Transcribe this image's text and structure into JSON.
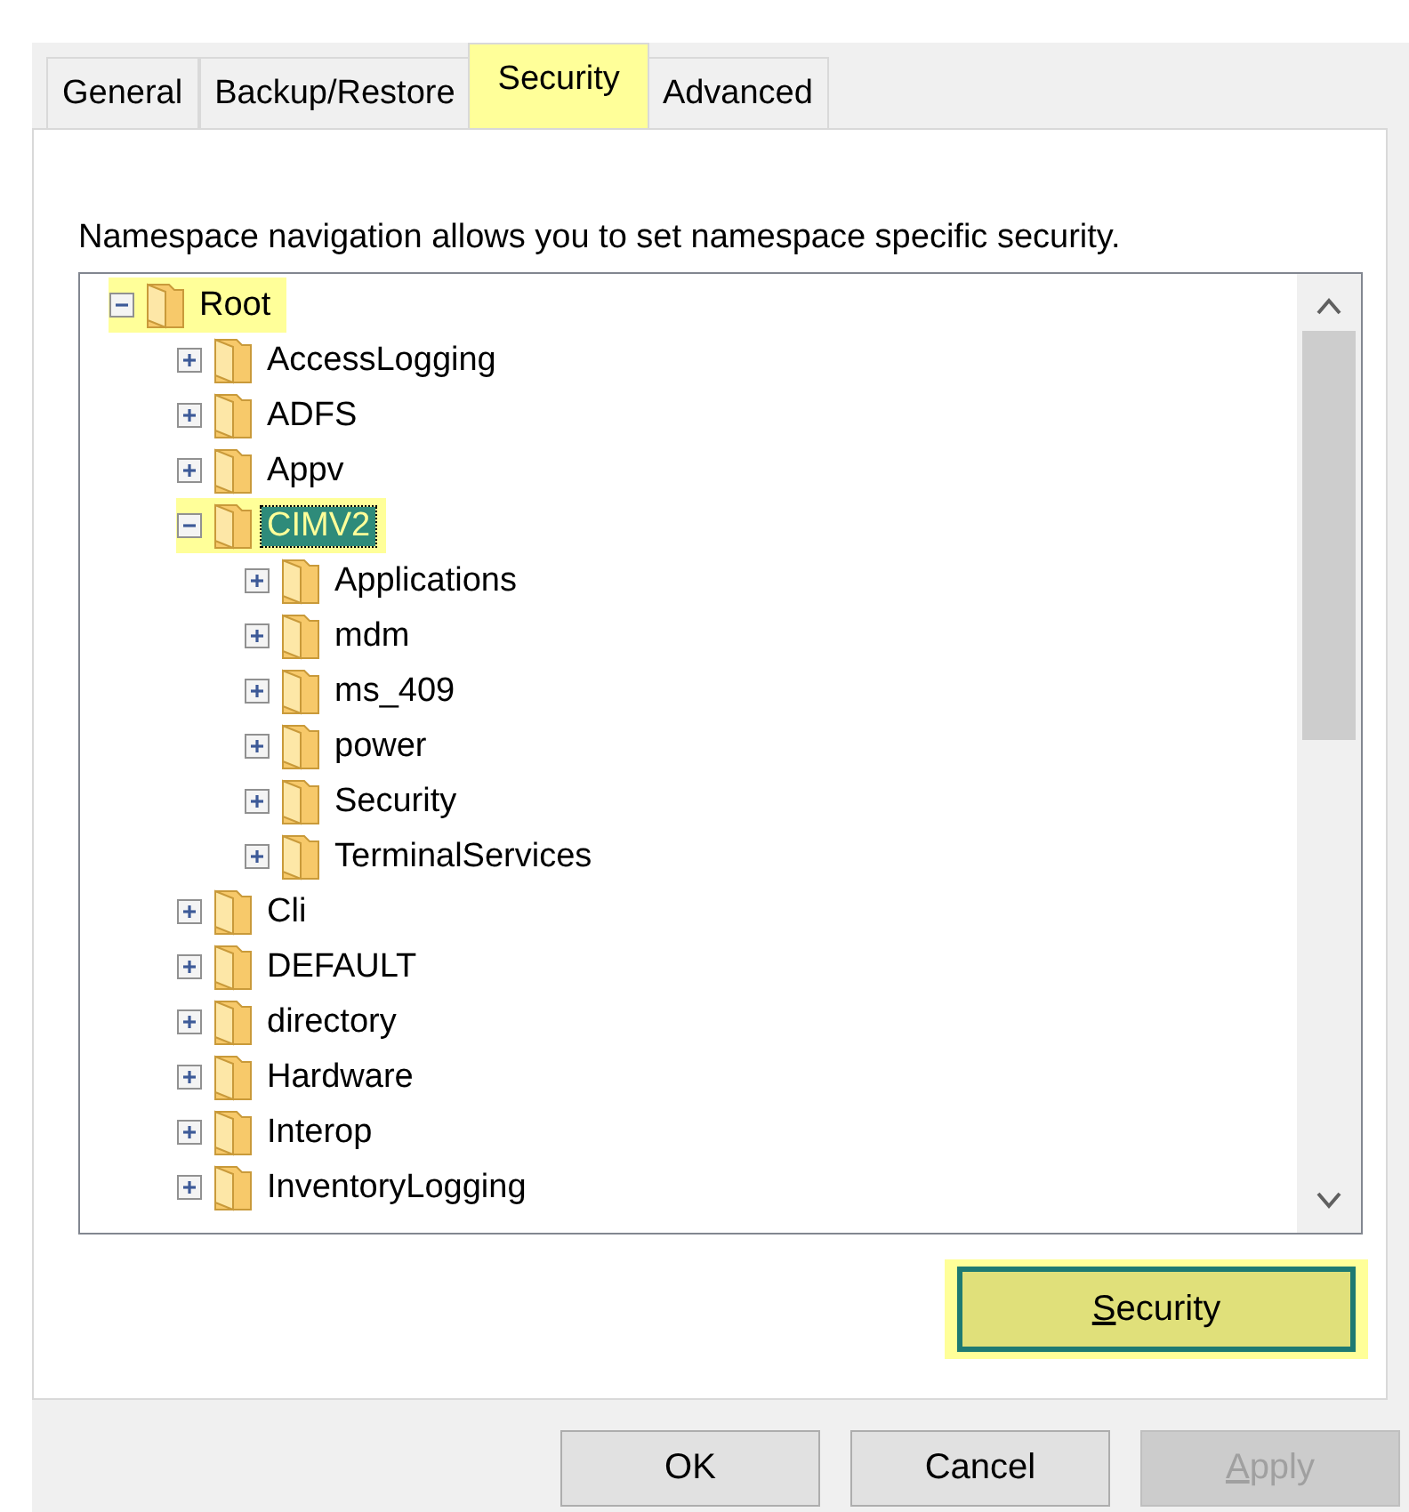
{
  "tabs": [
    {
      "label": "General",
      "selected": false,
      "highlighted": false
    },
    {
      "label": "Backup/Restore",
      "selected": false,
      "highlighted": false
    },
    {
      "label": "Security",
      "selected": true,
      "highlighted": true
    },
    {
      "label": "Advanced",
      "selected": false,
      "highlighted": false
    }
  ],
  "description": "Namespace navigation allows you to set namespace specific security.",
  "tree": [
    {
      "label": "Root",
      "expanded": true,
      "selected": false,
      "highlighted": true,
      "children": [
        {
          "label": "AccessLogging",
          "expanded": false,
          "selected": false,
          "highlighted": false
        },
        {
          "label": "ADFS",
          "expanded": false,
          "selected": false,
          "highlighted": false
        },
        {
          "label": "Appv",
          "expanded": false,
          "selected": false,
          "highlighted": false
        },
        {
          "label": "CIMV2",
          "expanded": true,
          "selected": true,
          "highlighted": true,
          "children": [
            {
              "label": "Applications",
              "expanded": false,
              "selected": false,
              "highlighted": false
            },
            {
              "label": "mdm",
              "expanded": false,
              "selected": false,
              "highlighted": false
            },
            {
              "label": "ms_409",
              "expanded": false,
              "selected": false,
              "highlighted": false
            },
            {
              "label": "power",
              "expanded": false,
              "selected": false,
              "highlighted": false
            },
            {
              "label": "Security",
              "expanded": false,
              "selected": false,
              "highlighted": false
            },
            {
              "label": "TerminalServices",
              "expanded": false,
              "selected": false,
              "highlighted": false
            }
          ]
        },
        {
          "label": "Cli",
          "expanded": false,
          "selected": false,
          "highlighted": false
        },
        {
          "label": "DEFAULT",
          "expanded": false,
          "selected": false,
          "highlighted": false
        },
        {
          "label": "directory",
          "expanded": false,
          "selected": false,
          "highlighted": false
        },
        {
          "label": "Hardware",
          "expanded": false,
          "selected": false,
          "highlighted": false
        },
        {
          "label": "Interop",
          "expanded": false,
          "selected": false,
          "highlighted": false
        },
        {
          "label": "InventoryLogging",
          "expanded": false,
          "selected": false,
          "highlighted": false
        }
      ]
    }
  ],
  "security_button": {
    "label": "Security",
    "highlighted": true,
    "mnemonic": true
  },
  "buttons": [
    {
      "label": "OK",
      "disabled": false,
      "mnemonic": false
    },
    {
      "label": "Cancel",
      "disabled": false,
      "mnemonic": false
    },
    {
      "label": "Apply",
      "disabled": true,
      "mnemonic": true
    }
  ]
}
